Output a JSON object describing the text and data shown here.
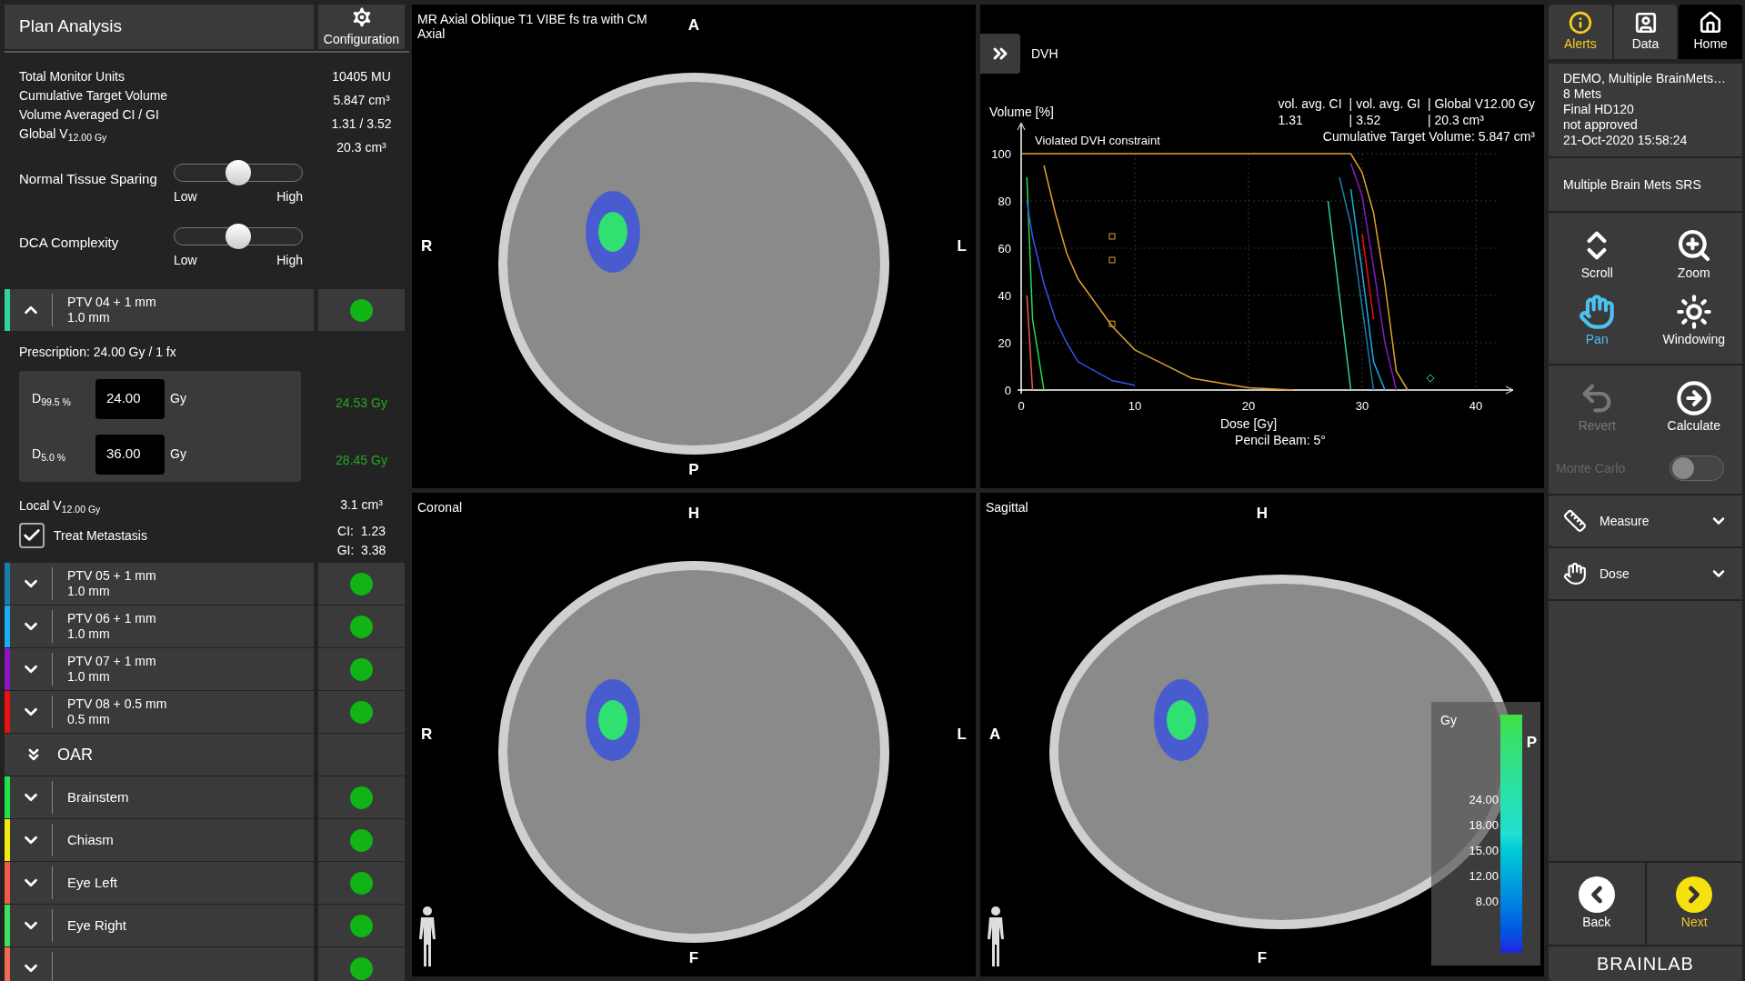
{
  "left_panel": {
    "title": "Plan Analysis",
    "config_button": "Configuration",
    "stats": [
      {
        "label": "Total Monitor Units",
        "value": "10405 MU"
      },
      {
        "label": "Cumulative Target Volume",
        "value": "5.847 cm³"
      },
      {
        "label": "Volume Averaged CI / GI",
        "value": "1.31 / 3.52"
      },
      {
        "label": "Global V$_{12.00 Gy}$",
        "value": "20.3 cm³"
      }
    ],
    "sliders": [
      {
        "label": "Normal Tissue Sparing",
        "level": 0.5,
        "min_label": "Low",
        "max_label": "High"
      },
      {
        "label": "DCA Complexity",
        "level": 0.5,
        "min_label": "Low",
        "max_label": "High"
      }
    ],
    "targets": [
      {
        "name": "PTV 04 + 1 mm",
        "margin": "1.0 mm",
        "color": "#2fd3a0",
        "expanded": true,
        "passed": true,
        "details": {
          "prescription": "Prescription: 24.00 Gy / 1 fx",
          "constraints": [
            {
              "label": "D$_{99.5 %}$",
              "value": "24.00",
              "unit": "Gy",
              "result": "24.53 Gy"
            },
            {
              "label": "D$_{5.0 %}$",
              "value": "36.00",
              "unit": "Gy",
              "result": "28.45 Gy"
            }
          ],
          "local_v": {
            "label": "Local V$_{12.00 Gy}$",
            "value": "3.1 cm³"
          },
          "treat": {
            "label": "Treat Metastasis",
            "checked": true
          },
          "ci": "CI:  1.23",
          "gi": "GI:  3.38"
        }
      },
      {
        "name": "PTV 05 + 1 mm",
        "margin": "1.0 mm",
        "color": "#1a7fa8",
        "expanded": false,
        "passed": true
      },
      {
        "name": "PTV 06 + 1 mm",
        "margin": "1.0 mm",
        "color": "#18aef0",
        "expanded": false,
        "passed": true
      },
      {
        "name": "PTV 07 + 1 mm",
        "margin": "1.0 mm",
        "color": "#8a18c0",
        "expanded": false,
        "passed": true
      },
      {
        "name": "PTV 08 + 0.5 mm",
        "margin": "0.5 mm",
        "color": "#ee1010",
        "expanded": false,
        "passed": true
      }
    ],
    "oar": {
      "label": "OAR",
      "expanded": true,
      "items": [
        {
          "name": "Brainstem",
          "color": "#22e04a",
          "expanded": false,
          "passed": true
        },
        {
          "name": "Chiasm",
          "color": "#f2ea10",
          "expanded": false,
          "passed": true
        },
        {
          "name": "Eye Left",
          "color": "#f05a48",
          "expanded": false,
          "passed": true
        },
        {
          "name": "Eye Right",
          "color": "#3ee060",
          "expanded": false,
          "passed": true
        },
        {
          "color": "#f06a5a",
          "expanded": false,
          "passed": true
        }
      ]
    }
  },
  "viewers": [
    {
      "kind": "axial",
      "title": "MR Axial Oblique T1 VIBE fs tra with CM",
      "subtitle": "Axial",
      "top": "A",
      "bottom": "P",
      "left": "R",
      "right": "L"
    },
    {
      "kind": "dvh"
    },
    {
      "kind": "coronal",
      "title": "Coronal",
      "top": "H",
      "bottom": "F",
      "left": "R",
      "right": "L"
    },
    {
      "kind": "sagittal",
      "title": "Sagittal",
      "top": "H",
      "bottom": "F",
      "left": "A",
      "right": "P",
      "scale": {
        "unit": "Gy",
        "ticks": [
          "24.00",
          "18.00",
          "15.00",
          "12.00",
          "8.00"
        ]
      }
    }
  ],
  "dvh": {
    "title": "DVH",
    "stats": {
      "headers": [
        "vol. avg. CI",
        "| vol. avg. GI",
        "| Global V12.00 Gy"
      ],
      "values": [
        "1.31",
        "| 3.52",
        "| 20.3 cm³"
      ],
      "total": "Cumulative Target Volume: 5.847 cm³"
    },
    "note": "Violated DVH constraint",
    "method": "Pencil Beam: 5°",
    "chart_data": {
      "type": "line",
      "grid": true,
      "xlabel": "Dose [Gy]",
      "ylabel": "Volume [%]",
      "xlim": [
        0,
        42
      ],
      "ylim": [
        0,
        100
      ],
      "xticks": [
        0,
        10,
        20,
        30,
        40
      ],
      "yticks": [
        0,
        20,
        40,
        60,
        80,
        100
      ],
      "x": [
        0,
        0.5,
        1,
        2,
        3,
        4,
        5,
        8,
        10,
        15,
        20,
        24,
        26,
        27,
        28,
        29,
        30,
        31,
        32,
        33,
        34
      ],
      "series": [
        {
          "color": "#22e04a",
          "values": [
            null,
            90,
            30,
            0,
            null,
            null,
            null,
            null,
            null,
            null,
            null,
            null,
            null,
            null,
            null,
            null,
            null,
            null,
            null,
            null,
            null
          ]
        },
        {
          "color": "#e0a030",
          "values": [
            null,
            null,
            null,
            95,
            75,
            58,
            47,
            27,
            17,
            5,
            1,
            0,
            null,
            null,
            null,
            null,
            null,
            null,
            null,
            null,
            null
          ]
        },
        {
          "color": "#f05a48",
          "values": [
            null,
            40,
            0,
            null,
            null,
            null,
            null,
            null,
            null,
            null,
            null,
            null,
            null,
            null,
            null,
            null,
            null,
            null,
            null,
            null,
            null
          ]
        },
        {
          "color": "#3355ee",
          "values": [
            null,
            80,
            65,
            45,
            30,
            20,
            12,
            4,
            2,
            null,
            null,
            null,
            null,
            null,
            null,
            null,
            null,
            null,
            null,
            null,
            null
          ]
        },
        {
          "color": "#2fd3a0",
          "values": [
            null,
            null,
            null,
            null,
            null,
            null,
            null,
            null,
            null,
            null,
            null,
            null,
            null,
            80,
            40,
            0,
            null,
            null,
            null,
            null,
            null
          ]
        },
        {
          "color": "#1a7fa8",
          "values": [
            null,
            null,
            null,
            null,
            null,
            null,
            null,
            null,
            null,
            null,
            null,
            null,
            null,
            null,
            90,
            70,
            35,
            0,
            null,
            null,
            null
          ]
        },
        {
          "color": "#18aef0",
          "values": [
            null,
            null,
            null,
            null,
            null,
            null,
            null,
            null,
            null,
            null,
            null,
            null,
            null,
            null,
            null,
            85,
            50,
            12,
            0,
            null,
            null
          ]
        },
        {
          "color": "#8a18c0",
          "values": [
            null,
            null,
            null,
            null,
            null,
            null,
            null,
            null,
            null,
            null,
            null,
            null,
            null,
            null,
            null,
            96,
            82,
            52,
            20,
            0,
            null
          ]
        },
        {
          "color": "#ee1010",
          "values": [
            null,
            null,
            null,
            null,
            null,
            null,
            null,
            null,
            null,
            null,
            null,
            null,
            null,
            null,
            null,
            null,
            66,
            30,
            null,
            null,
            null
          ]
        },
        {
          "color": "#e0a030",
          "values": [
            100,
            100,
            100,
            100,
            100,
            100,
            100,
            100,
            100,
            100,
            100,
            100,
            100,
            100,
            100,
            100,
            92,
            75,
            45,
            8,
            0
          ]
        }
      ]
    }
  },
  "right_panel": {
    "tabs": [
      {
        "label": "Alerts",
        "kind": "alerts",
        "selected": false
      },
      {
        "label": "Data",
        "kind": "data",
        "selected": false
      },
      {
        "label": "Home",
        "kind": "home",
        "selected": true
      }
    ],
    "patient": [
      "DEMO, Multiple BrainMets…",
      "8 Mets",
      "Final HD120",
      "not approved",
      "21-Oct-2020 15:58:24"
    ],
    "plan": "Multiple Brain Mets SRS",
    "tools": [
      {
        "label": "Scroll",
        "kind": "scroll",
        "selected": false
      },
      {
        "label": "Zoom",
        "kind": "zoom",
        "selected": false
      },
      {
        "label": "Pan",
        "kind": "pan",
        "selected": true
      },
      {
        "label": "Windowing",
        "kind": "windowing",
        "selected": false
      }
    ],
    "actions": [
      {
        "label": "Revert",
        "kind": "revert",
        "disabled": true
      },
      {
        "label": "Calculate",
        "kind": "calculate",
        "disabled": false
      }
    ],
    "monte_carlo": {
      "label": "Monte Carlo",
      "on": false,
      "disabled": true
    },
    "sections": [
      {
        "label": "Measure",
        "kind": "measure",
        "expanded": false
      },
      {
        "label": "Dose",
        "kind": "dose",
        "expanded": false
      }
    ],
    "nav": [
      {
        "label": "Back",
        "kind": "back"
      },
      {
        "label": "Next",
        "kind": "next"
      }
    ],
    "logo": "BRAINLAB"
  }
}
